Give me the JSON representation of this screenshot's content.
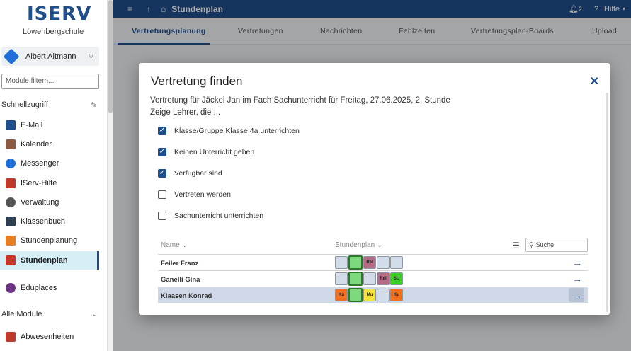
{
  "sidebar": {
    "logo": "ISERV",
    "school": "Löwenbergschule",
    "user": "Albert Altmann",
    "filter_placeholder": "Module filtern...",
    "quick_access": "Schnellzugriff",
    "items": [
      {
        "label": "E-Mail",
        "icon": "mail-icon",
        "color": "#1f4e8c"
      },
      {
        "label": "Kalender",
        "icon": "calendar-icon",
        "color": "#8a5a44"
      },
      {
        "label": "Messenger",
        "icon": "messenger-icon",
        "color": "#1f6fd9"
      },
      {
        "label": "IServ-Hilfe",
        "icon": "help-icon",
        "color": "#c0392b"
      },
      {
        "label": "Verwaltung",
        "icon": "gear-icon",
        "color": "#555555"
      },
      {
        "label": "Klassenbuch",
        "icon": "book-icon",
        "color": "#2c3e50"
      },
      {
        "label": "Stundenplanung",
        "icon": "planning-icon",
        "color": "#e67e22"
      },
      {
        "label": "Stundenplan",
        "icon": "timetable-icon",
        "color": "#c0392b"
      },
      {
        "label": "Eduplaces",
        "icon": "eduplaces-icon",
        "color": "#6c3483"
      }
    ],
    "all_modules": "Alle Module",
    "absences": "Abwesenheiten"
  },
  "topbar": {
    "title": "Stundenplan",
    "notifications": "2",
    "help": "Hilfe"
  },
  "tabs": [
    "Vertretungsplanung",
    "Vertretungen",
    "Nachrichten",
    "Fehlzeiten",
    "Vertretungsplan-Boards",
    "Upload"
  ],
  "modal": {
    "title": "Vertretung finden",
    "description": "Vertretung für Jäckel Jan im Fach Sachunterricht für Freitag, 27.06.2025, 2. Stunde",
    "subtitle": "Zeige Lehrer, die ...",
    "options": [
      {
        "label": "Klasse/Gruppe Klasse 4a unterrichten",
        "checked": true
      },
      {
        "label": "Keinen Unterricht geben",
        "checked": true
      },
      {
        "label": "Verfügbar sind",
        "checked": true
      },
      {
        "label": "Vertreten werden",
        "checked": false
      },
      {
        "label": "Sachunterricht unterrichten",
        "checked": false
      }
    ],
    "col_name": "Name",
    "col_schedule": "Stundenplan",
    "search_placeholder": "Suche",
    "teachers": [
      {
        "name": "Feiler Franz",
        "cells": [
          {
            "t": "",
            "c": "#d3dde9"
          },
          {
            "t": "",
            "c": "#7ed87e",
            "cur": true
          },
          {
            "t": "Rel",
            "c": "#b56b86"
          },
          {
            "t": "",
            "c": "#d3dde9"
          },
          {
            "t": "",
            "c": "#d3dde9"
          }
        ]
      },
      {
        "name": "Ganelli Gina",
        "cells": [
          {
            "t": "",
            "c": "#d3dde9"
          },
          {
            "t": "",
            "c": "#7ed87e",
            "cur": true
          },
          {
            "t": "",
            "c": "#d3dde9"
          },
          {
            "t": "Rel",
            "c": "#b56b86"
          },
          {
            "t": "SU",
            "c": "#3ccf2a"
          }
        ]
      },
      {
        "name": "Klaasen Konrad",
        "cells": [
          {
            "t": "Ku",
            "c": "#f07020"
          },
          {
            "t": "",
            "c": "#7ed87e",
            "cur": true
          },
          {
            "t": "Mu",
            "c": "#f5e33a"
          },
          {
            "t": "",
            "c": "#d3dde9"
          },
          {
            "t": "Ku",
            "c": "#f07020"
          }
        ]
      }
    ]
  }
}
